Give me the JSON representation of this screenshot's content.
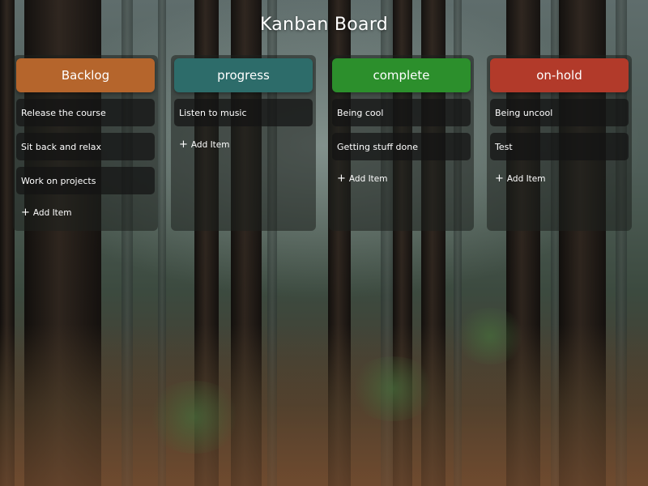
{
  "board": {
    "title": "Kanban Board"
  },
  "columns": [
    {
      "title": "Backlog",
      "color": "#b5652c",
      "items": [
        "Release the course",
        "Sit back and relax",
        "Work on projects"
      ],
      "add_label": "Add Item"
    },
    {
      "title": "progress",
      "color": "#2d6c6a",
      "items": [
        "Listen to music"
      ],
      "add_label": "Add Item"
    },
    {
      "title": "complete",
      "color": "#2c8f2c",
      "items": [
        "Being cool",
        "Getting stuff done"
      ],
      "add_label": "Add Item"
    },
    {
      "title": "on-hold",
      "color": "#b23a2a",
      "items": [
        "Being uncool",
        "Test"
      ],
      "add_label": "Add Item"
    }
  ],
  "icons": {
    "add": "plus-icon"
  }
}
